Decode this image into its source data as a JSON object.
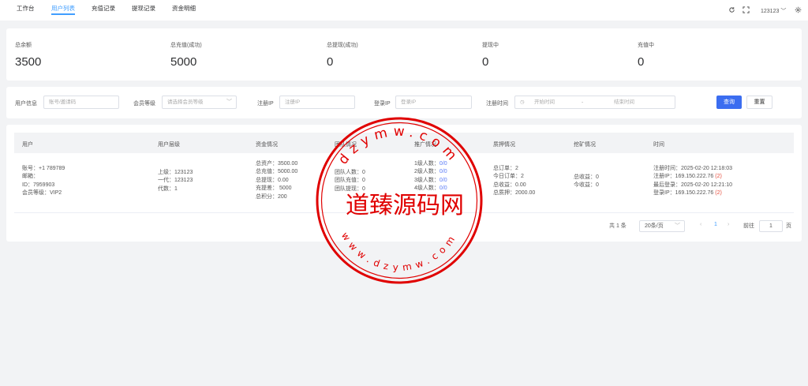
{
  "nav": {
    "tabs": [
      "工作台",
      "用户列表",
      "充值记录",
      "提现记录",
      "资金明细"
    ],
    "active_tab": 1,
    "username": "123123"
  },
  "stats": [
    {
      "label": "总余额",
      "value": "3500"
    },
    {
      "label": "总充值(成功)",
      "value": "5000"
    },
    {
      "label": "总提现(成功)",
      "value": "0"
    },
    {
      "label": "提现中",
      "value": "0"
    },
    {
      "label": "充值中",
      "value": "0"
    }
  ],
  "filters": {
    "user_info_label": "用户信息",
    "user_info_placeholder": "账号/邀请码",
    "level_label": "会员等级",
    "level_placeholder": "请选择会员等级",
    "reg_ip_label": "注册IP",
    "reg_ip_placeholder": "注册IP",
    "login_ip_label": "登录IP",
    "login_ip_placeholder": "登录IP",
    "reg_time_label": "注册时间",
    "start_placeholder": "开始时间",
    "range_sep": "-",
    "end_placeholder": "结束时间",
    "search_btn": "查询",
    "reset_btn": "重置"
  },
  "table": {
    "headers": [
      "用户",
      "用户层级",
      "资金情况",
      "团队情况",
      "推广情况",
      "质押情况",
      "挖矿情况",
      "时间"
    ],
    "row": {
      "user": [
        "账号：+1 789789",
        "邮箱：",
        "ID：7959903",
        "会员等级：VIP2"
      ],
      "level": [
        "上级：123123",
        "一代：123123",
        "代数：1"
      ],
      "funds": [
        "总资产：3500.00",
        "总充值：5000.00",
        "总提现：0.00",
        "充提差： 5000",
        "总积分：200"
      ],
      "team": [
        "团队人数：0",
        "团队充值：0",
        "团队提现：0"
      ],
      "promo_labels": [
        "1级人数：",
        "2级人数：",
        "3级人数：",
        "4级人数："
      ],
      "promo_values": [
        "0/0",
        "0/0",
        "0/0",
        "0/0"
      ],
      "pledge": [
        "总订单：2",
        "今日订单：2",
        "总收益：0.00",
        "总质押：2000.00"
      ],
      "mining": [
        "总收益：0",
        "今收益：0"
      ],
      "time": [
        "注册时间：2025-02-20 12:18:03",
        "注册IP：169.150.222.76",
        "最后登录：2025-02-20 12:21:10",
        "登录IP：169.150.222.76"
      ],
      "time_counts": [
        "(2)",
        "(2)"
      ]
    }
  },
  "pagination": {
    "total": "共 1 条",
    "page_size": "20条/页",
    "current": "1",
    "goto_label": "前往",
    "goto_value": "1",
    "goto_suffix": "页"
  },
  "watermark": {
    "top_text": "dzymw.com",
    "bottom_text": "www.dzymw.com",
    "center_text": "道臻源码网",
    "color": "#e00000"
  }
}
